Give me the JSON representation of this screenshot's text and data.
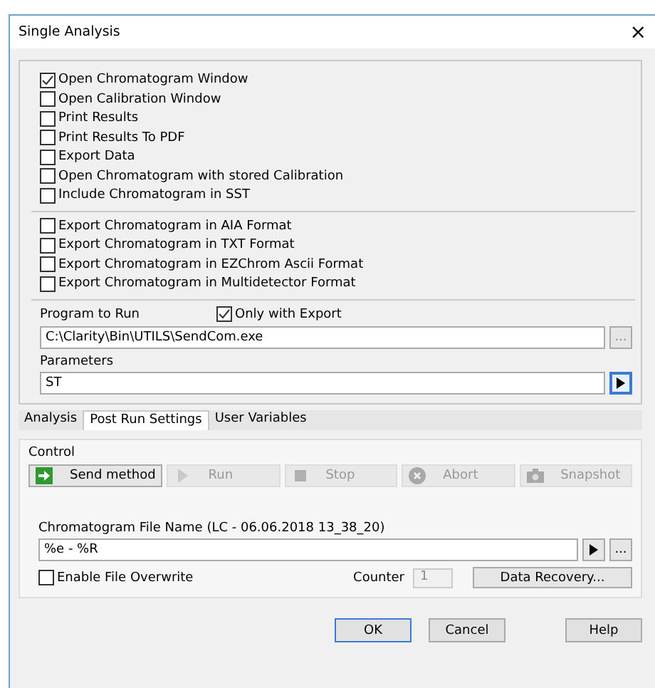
{
  "window": {
    "title": "Single Analysis",
    "close": "×"
  },
  "option_groups": [
    [
      {
        "label": "Open Chromatogram Window",
        "checked": true
      },
      {
        "label": "Open Calibration Window",
        "checked": false
      },
      {
        "label": "Print Results",
        "checked": false
      },
      {
        "label": "Print Results To PDF",
        "checked": false
      },
      {
        "label": "Export Data",
        "checked": false
      },
      {
        "label": "Open Chromatogram with stored Calibration",
        "checked": false
      },
      {
        "label": "Include Chromatogram in SST",
        "checked": false
      }
    ],
    [
      {
        "label": "Export Chromatogram in AIA Format",
        "checked": false
      },
      {
        "label": "Export Chromatogram in TXT Format",
        "checked": false
      },
      {
        "label": "Export Chromatogram in EZChrom Ascii Format",
        "checked": false
      },
      {
        "label": "Export Chromatogram in Multidetector Format",
        "checked": false
      }
    ]
  ],
  "program": {
    "label": "Program to Run",
    "only_with_export": {
      "label": "Only with Export",
      "checked": true
    },
    "value": "C:\\Clarity\\Bin\\UTILS\\SendCom.exe",
    "browse": "..."
  },
  "parameters": {
    "label": "Parameters",
    "value": "ST"
  },
  "tabs": [
    {
      "label": "Analysis",
      "selected": false
    },
    {
      "label": "Post Run Settings",
      "selected": true
    },
    {
      "label": "User Variables",
      "selected": false
    }
  ],
  "control": {
    "title": "Control",
    "buttons": [
      {
        "label": "Send method",
        "kind": "send",
        "disabled": false
      },
      {
        "label": "Run",
        "kind": "run",
        "disabled": true
      },
      {
        "label": "Stop",
        "kind": "stop",
        "disabled": true
      },
      {
        "label": "Abort",
        "kind": "abort",
        "disabled": true
      },
      {
        "label": "Snapshot",
        "kind": "snapshot",
        "disabled": true
      }
    ]
  },
  "file_name": {
    "label": "Chromatogram File Name (LC - 06.06.2018 13_38_20)",
    "value": "%e - %R",
    "browse": "...",
    "overwrite": {
      "label": "Enable File Overwrite",
      "checked": false
    },
    "counter_label": "Counter",
    "counter": "1",
    "recovery": "Data Recovery..."
  },
  "buttons": [
    {
      "label": "OK",
      "kind": "default"
    },
    {
      "label": "Cancel",
      "kind": "normal"
    },
    {
      "label": "Help",
      "kind": "help"
    }
  ]
}
